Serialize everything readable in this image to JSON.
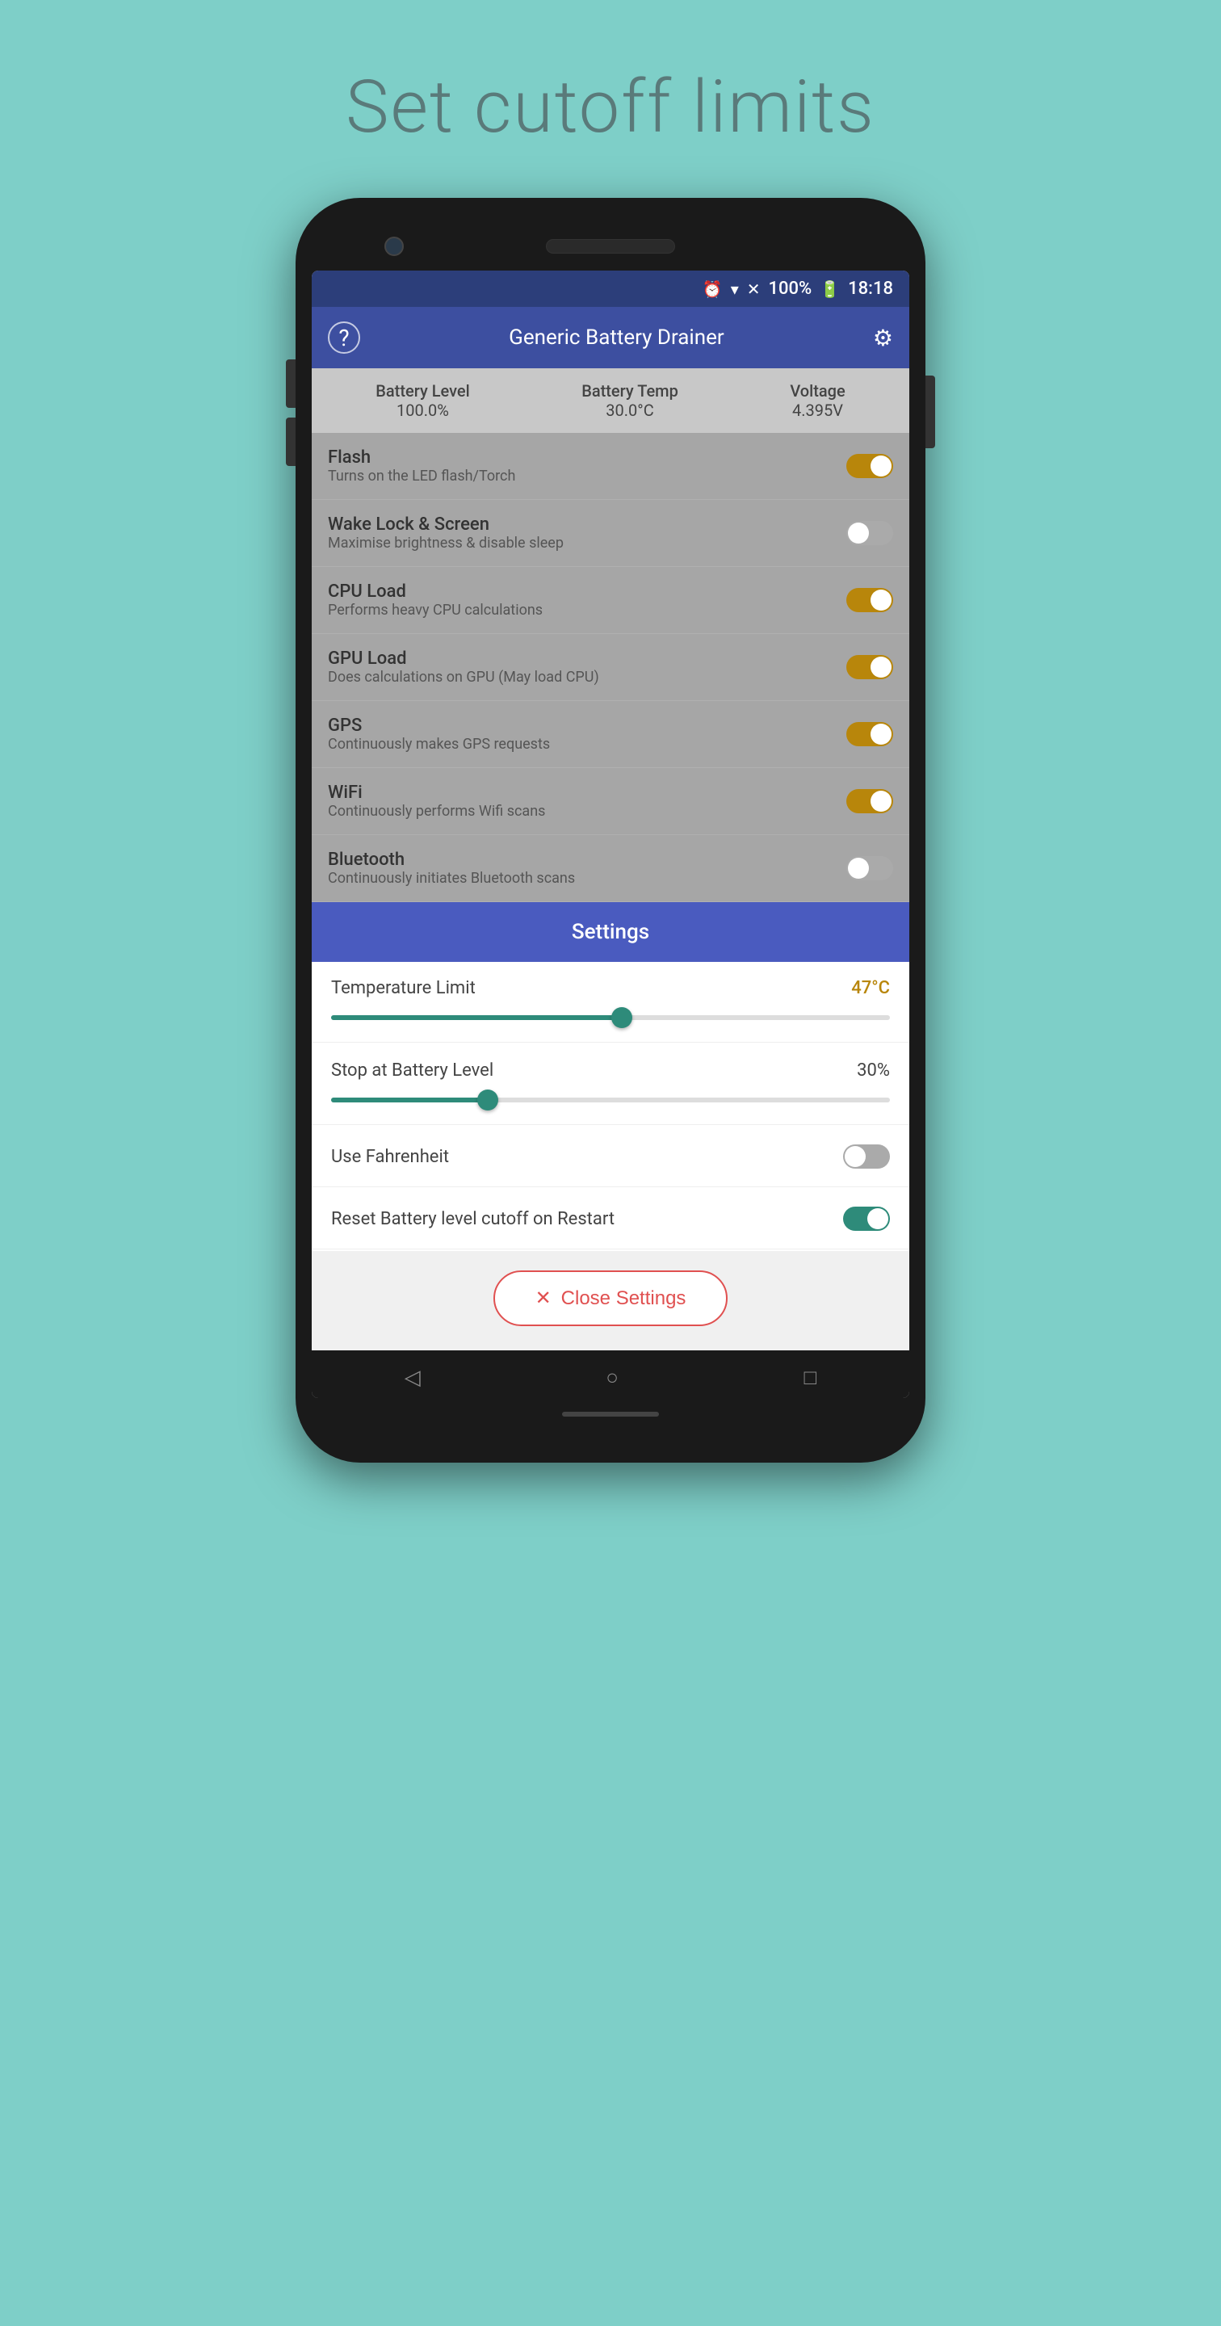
{
  "page": {
    "title": "Set cutoff limits",
    "bg_color": "#7ecfc8"
  },
  "status_bar": {
    "time": "18:18",
    "battery": "100%",
    "icons": [
      "alarm",
      "wifi",
      "signal",
      "battery"
    ]
  },
  "app_header": {
    "title": "Generic Battery Drainer",
    "help_icon": "?",
    "settings_icon": "⚙"
  },
  "stats": [
    {
      "label": "Battery Level",
      "value": "100.0%"
    },
    {
      "label": "Battery Temp",
      "value": "30.0°C"
    },
    {
      "label": "Voltage",
      "value": "4.395V"
    }
  ],
  "features": [
    {
      "name": "Flash",
      "desc": "Turns on the LED flash/Torch",
      "state": "on"
    },
    {
      "name": "Wake Lock & Screen",
      "desc": "Maximise brightness & disable sleep",
      "state": "off"
    },
    {
      "name": "CPU Load",
      "desc": "Performs heavy CPU calculations",
      "state": "on"
    },
    {
      "name": "GPU Load",
      "desc": "Does calculations on GPU (May load CPU)",
      "state": "on"
    },
    {
      "name": "GPS",
      "desc": "Continuously makes GPS requests",
      "state": "on"
    },
    {
      "name": "WiFi",
      "desc": "Continuously performs Wifi scans",
      "state": "on"
    },
    {
      "name": "Bluetooth",
      "desc": "Continuously initiates Bluetooth scans",
      "state": "off"
    }
  ],
  "settings": {
    "header_label": "Settings",
    "temp_limit_label": "Temperature Limit",
    "temp_limit_value": "47°C",
    "temp_limit_percent": 52,
    "battery_level_label": "Stop at Battery Level",
    "battery_level_value": "30%",
    "battery_level_percent": 28,
    "fahrenheit_label": "Use Fahrenheit",
    "fahrenheit_state": "off",
    "reset_label": "Reset Battery level cutoff on Restart",
    "reset_state": "on",
    "close_button_label": "Close Settings"
  },
  "nav": {
    "back": "◁",
    "home": "○",
    "recent": "□"
  }
}
